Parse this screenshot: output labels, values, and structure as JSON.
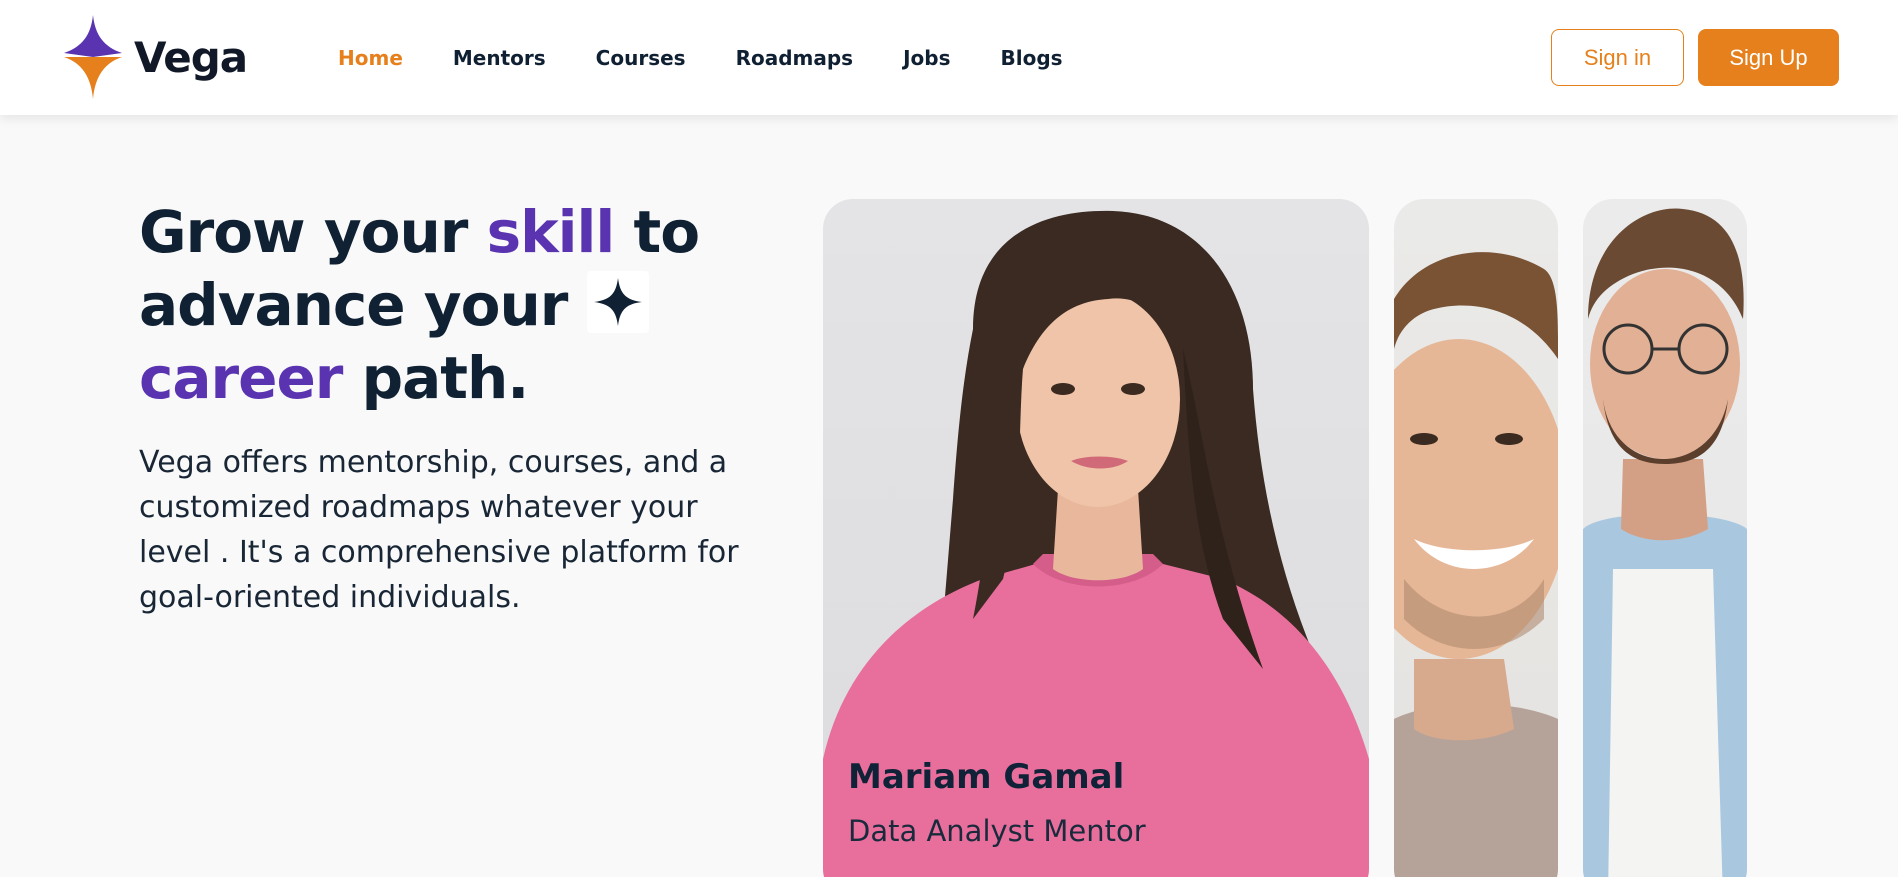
{
  "brand": {
    "name": "Vega",
    "logo_icon": "four-point-star-logo",
    "colors": {
      "purple": "#5a34b0",
      "orange": "#e5801c"
    }
  },
  "nav": {
    "items": [
      {
        "label": "Home",
        "active": true
      },
      {
        "label": "Mentors",
        "active": false
      },
      {
        "label": "Courses",
        "active": false
      },
      {
        "label": "Roadmaps",
        "active": false
      },
      {
        "label": "Jobs",
        "active": false
      },
      {
        "label": "Blogs",
        "active": false
      }
    ]
  },
  "auth": {
    "signin_label": "Sign in",
    "signup_label": "Sign Up"
  },
  "hero": {
    "title_parts": [
      "Grow your ",
      "skill",
      " to advance your ",
      "career",
      " path."
    ],
    "sparkle_icon": "sparkle-icon",
    "description": "Vega offers mentorship, courses, and a customized roadmaps whatever your level . It's a comprehensive platform for goal-oriented individuals."
  },
  "mentors": [
    {
      "name": "Mariam Gamal",
      "role": "Data Analyst Mentor"
    }
  ]
}
